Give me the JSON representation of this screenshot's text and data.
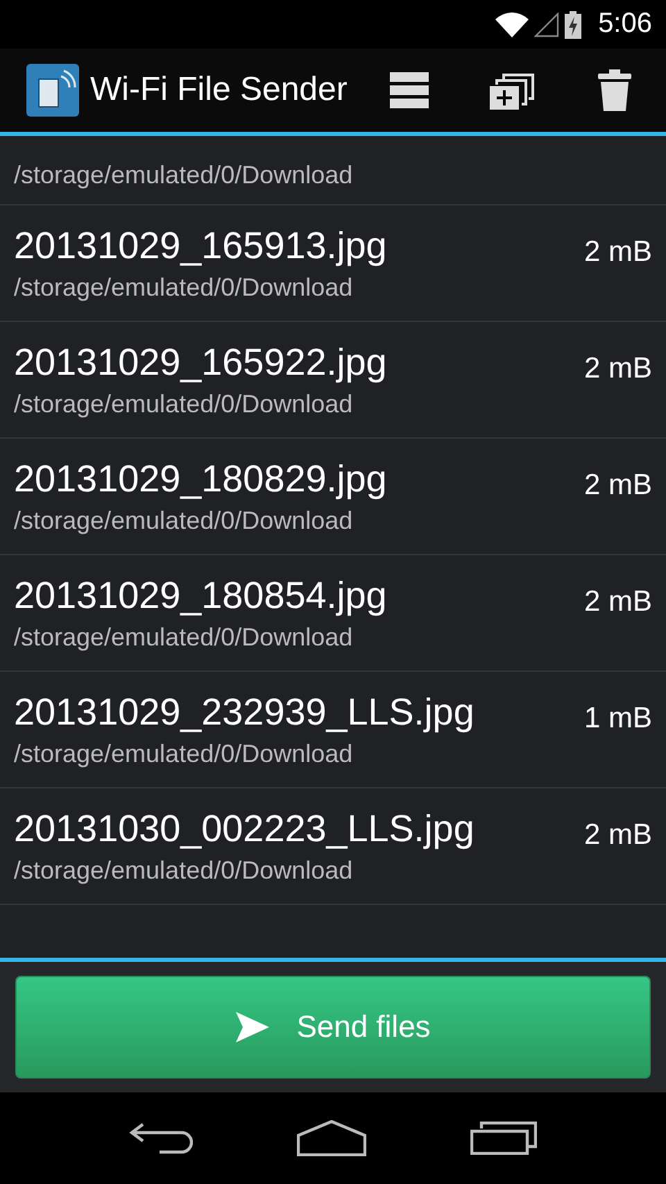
{
  "status_bar": {
    "time": "5:06"
  },
  "action_bar": {
    "title": "Wi-Fi File Sender"
  },
  "files": [
    {
      "path": "/storage/emulated/0/Download"
    },
    {
      "name": "20131029_165913.jpg",
      "path": "/storage/emulated/0/Download",
      "size": "2 mB"
    },
    {
      "name": "20131029_165922.jpg",
      "path": "/storage/emulated/0/Download",
      "size": "2 mB"
    },
    {
      "name": "20131029_180829.jpg",
      "path": "/storage/emulated/0/Download",
      "size": "2 mB"
    },
    {
      "name": "20131029_180854.jpg",
      "path": "/storage/emulated/0/Download",
      "size": "2 mB"
    },
    {
      "name": "20131029_232939_LLS.jpg",
      "path": "/storage/emulated/0/Download",
      "size": "1 mB"
    },
    {
      "name": "20131030_002223_LLS.jpg",
      "path": "/storage/emulated/0/Download",
      "size": "2 mB"
    }
  ],
  "send_button": {
    "label": "Send files"
  }
}
